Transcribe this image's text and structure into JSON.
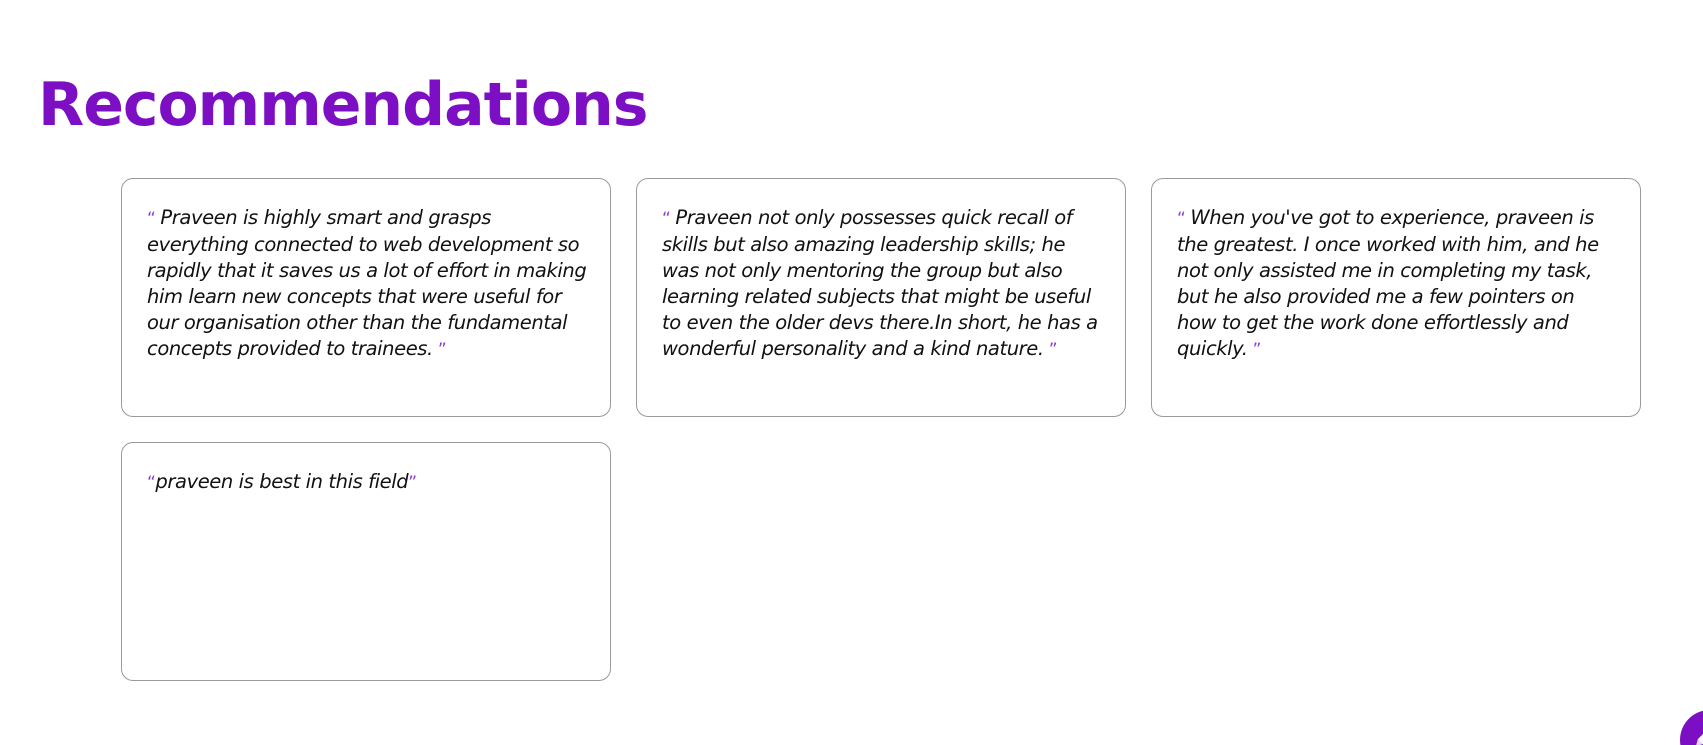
{
  "section": {
    "title": "Recommendations"
  },
  "recommendations": [
    {
      "open_mark": "“ ",
      "text": "Praveen is highly smart and grasps everything connected to web development so rapidly that it saves us a lot of effort in making him learn new concepts that were useful for our organisation other than the fundamental concepts provided to trainees.",
      "close_mark": " ”"
    },
    {
      "open_mark": "“ ",
      "text": "Praveen not only possesses quick recall of skills but also amazing leadership skills; he was not only mentoring the group but also learning related subjects that might be useful to even the older devs there.In short, he has a wonderful personality and a kind nature.",
      "close_mark": " ”"
    },
    {
      "open_mark": "“ ",
      "text": "When you've got to experience, praveen is the greatest. I once worked with him, and he not only assisted me in completing my task, but he also provided me a few pointers on how to get the work done effortlessly and quickly.",
      "close_mark": " ”"
    },
    {
      "open_mark": "“",
      "text": "praveen is best in this field",
      "close_mark": "”"
    }
  ],
  "fab": {
    "icon": "pencil-icon",
    "color": "#7c0fc4"
  },
  "colors": {
    "accent": "#7c0fc4",
    "card_border": "#9a9a9a",
    "text": "#111111"
  }
}
